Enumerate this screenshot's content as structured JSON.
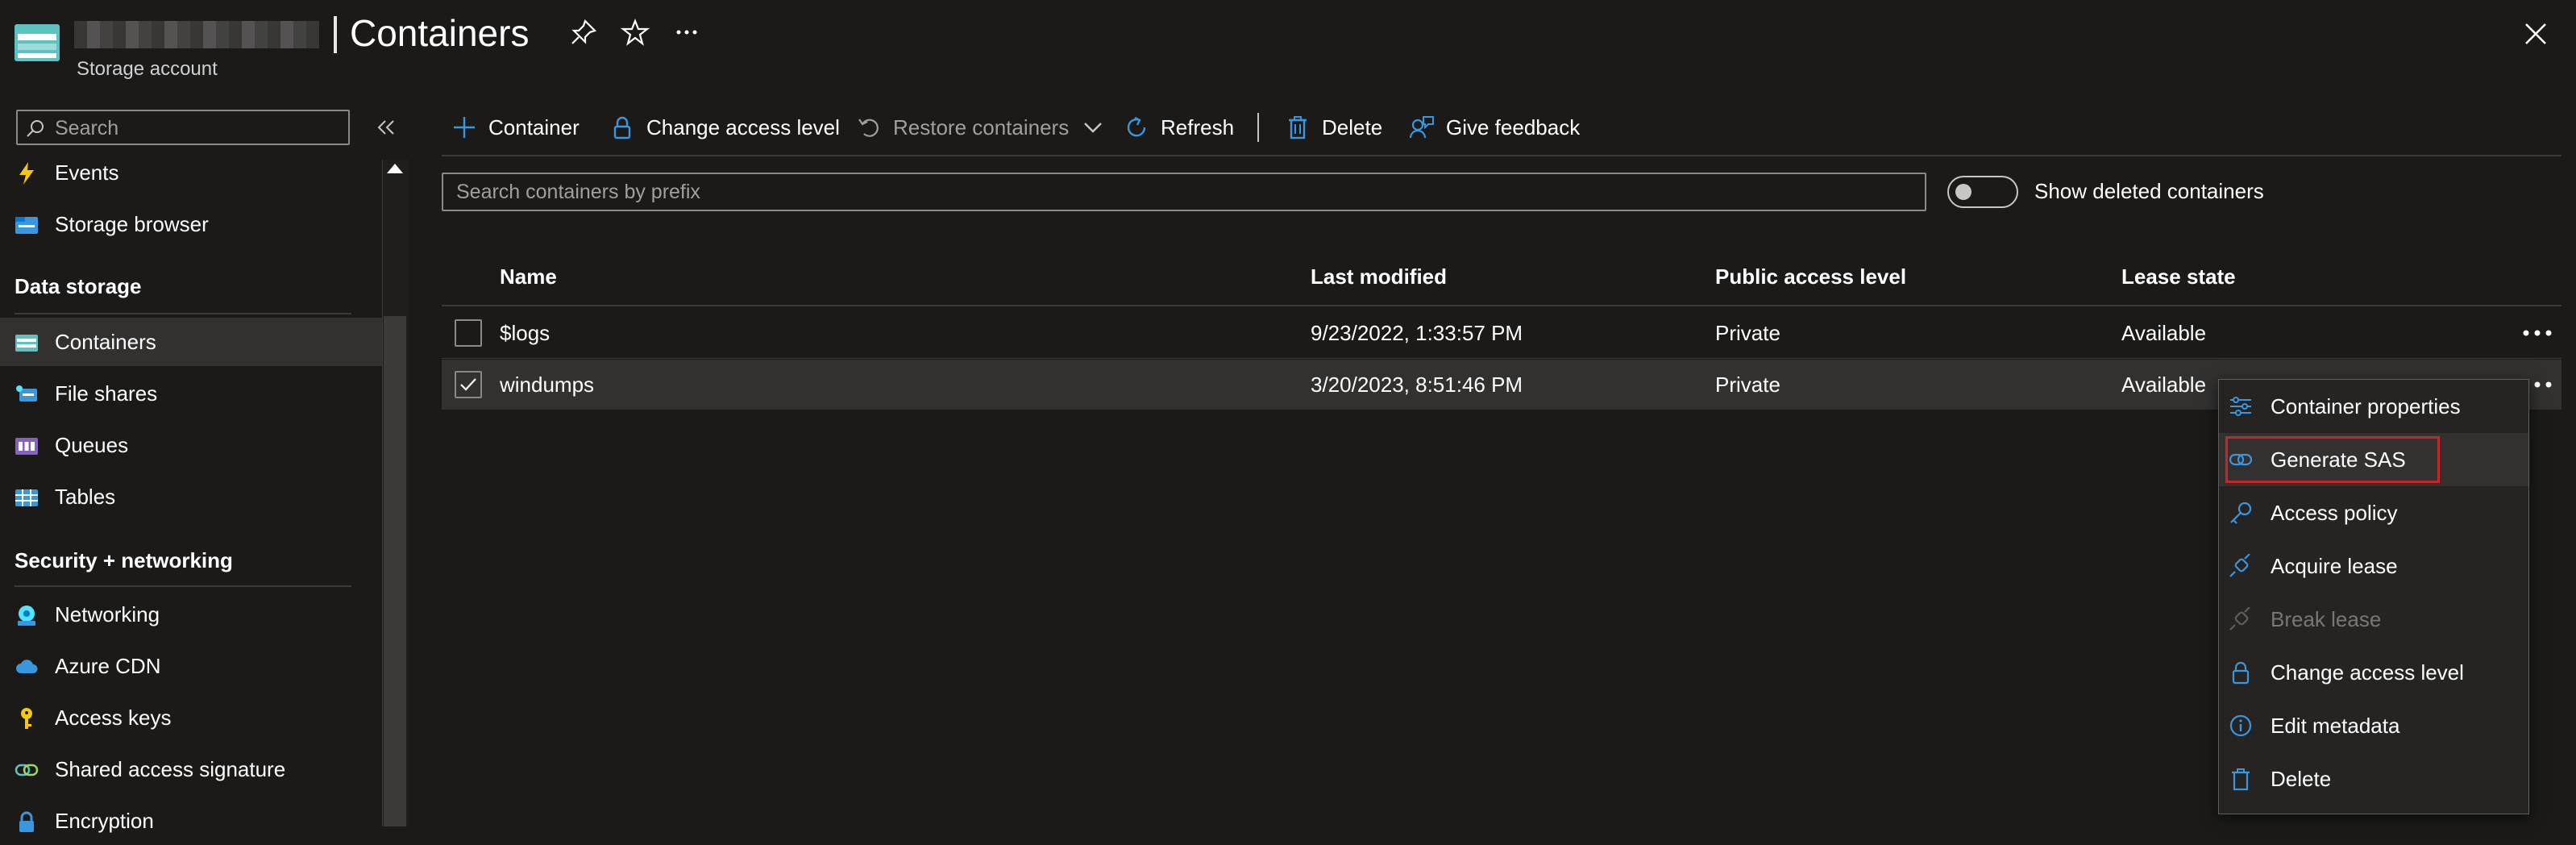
{
  "header": {
    "title": "Containers",
    "subtitle": "Storage account"
  },
  "sidebar": {
    "search_placeholder": "Search",
    "items_top": [
      {
        "label": "Events",
        "icon": "lightning-icon"
      },
      {
        "label": "Storage browser",
        "icon": "storage-browser-icon"
      }
    ],
    "data_storage": {
      "section": "Data storage",
      "items": [
        {
          "label": "Containers",
          "icon": "containers-icon",
          "active": true
        },
        {
          "label": "File shares",
          "icon": "file-shares-icon"
        },
        {
          "label": "Queues",
          "icon": "queues-icon"
        },
        {
          "label": "Tables",
          "icon": "tables-icon"
        }
      ]
    },
    "security": {
      "section": "Security + networking",
      "items": [
        {
          "label": "Networking",
          "icon": "networking-icon"
        },
        {
          "label": "Azure CDN",
          "icon": "cloud-icon"
        },
        {
          "label": "Access keys",
          "icon": "key-icon"
        },
        {
          "label": "Shared access signature",
          "icon": "link-icon"
        },
        {
          "label": "Encryption",
          "icon": "lock-icon"
        }
      ]
    }
  },
  "toolbar": {
    "add_container": "Container",
    "change_access": "Change access level",
    "restore": "Restore containers",
    "refresh": "Refresh",
    "delete": "Delete",
    "feedback": "Give feedback"
  },
  "filter": {
    "placeholder": "Search containers by prefix",
    "toggle_label": "Show deleted containers"
  },
  "table": {
    "headers": [
      "Name",
      "Last modified",
      "Public access level",
      "Lease state"
    ],
    "rows": [
      {
        "name": "$logs",
        "modified": "9/23/2022, 1:33:57 PM",
        "access": "Private",
        "lease": "Available",
        "checked": false
      },
      {
        "name": "windumps",
        "modified": "3/20/2023, 8:51:46 PM",
        "access": "Private",
        "lease": "Available",
        "checked": true
      }
    ]
  },
  "context_menu": {
    "items": [
      {
        "label": "Container properties",
        "icon": "sliders-icon"
      },
      {
        "label": "Generate SAS",
        "icon": "link-icon"
      },
      {
        "label": "Access policy",
        "icon": "key-icon"
      },
      {
        "label": "Acquire lease",
        "icon": "plug-icon"
      },
      {
        "label": "Break lease",
        "icon": "plug-icon",
        "disabled": true
      },
      {
        "label": "Change access level",
        "icon": "lock-icon"
      },
      {
        "label": "Edit metadata",
        "icon": "info-icon"
      },
      {
        "label": "Delete",
        "icon": "trash-icon"
      }
    ]
  },
  "colors": {
    "accent": "#3a96dd",
    "background": "#1b1a19",
    "highlight_outline": "#c4262e"
  }
}
